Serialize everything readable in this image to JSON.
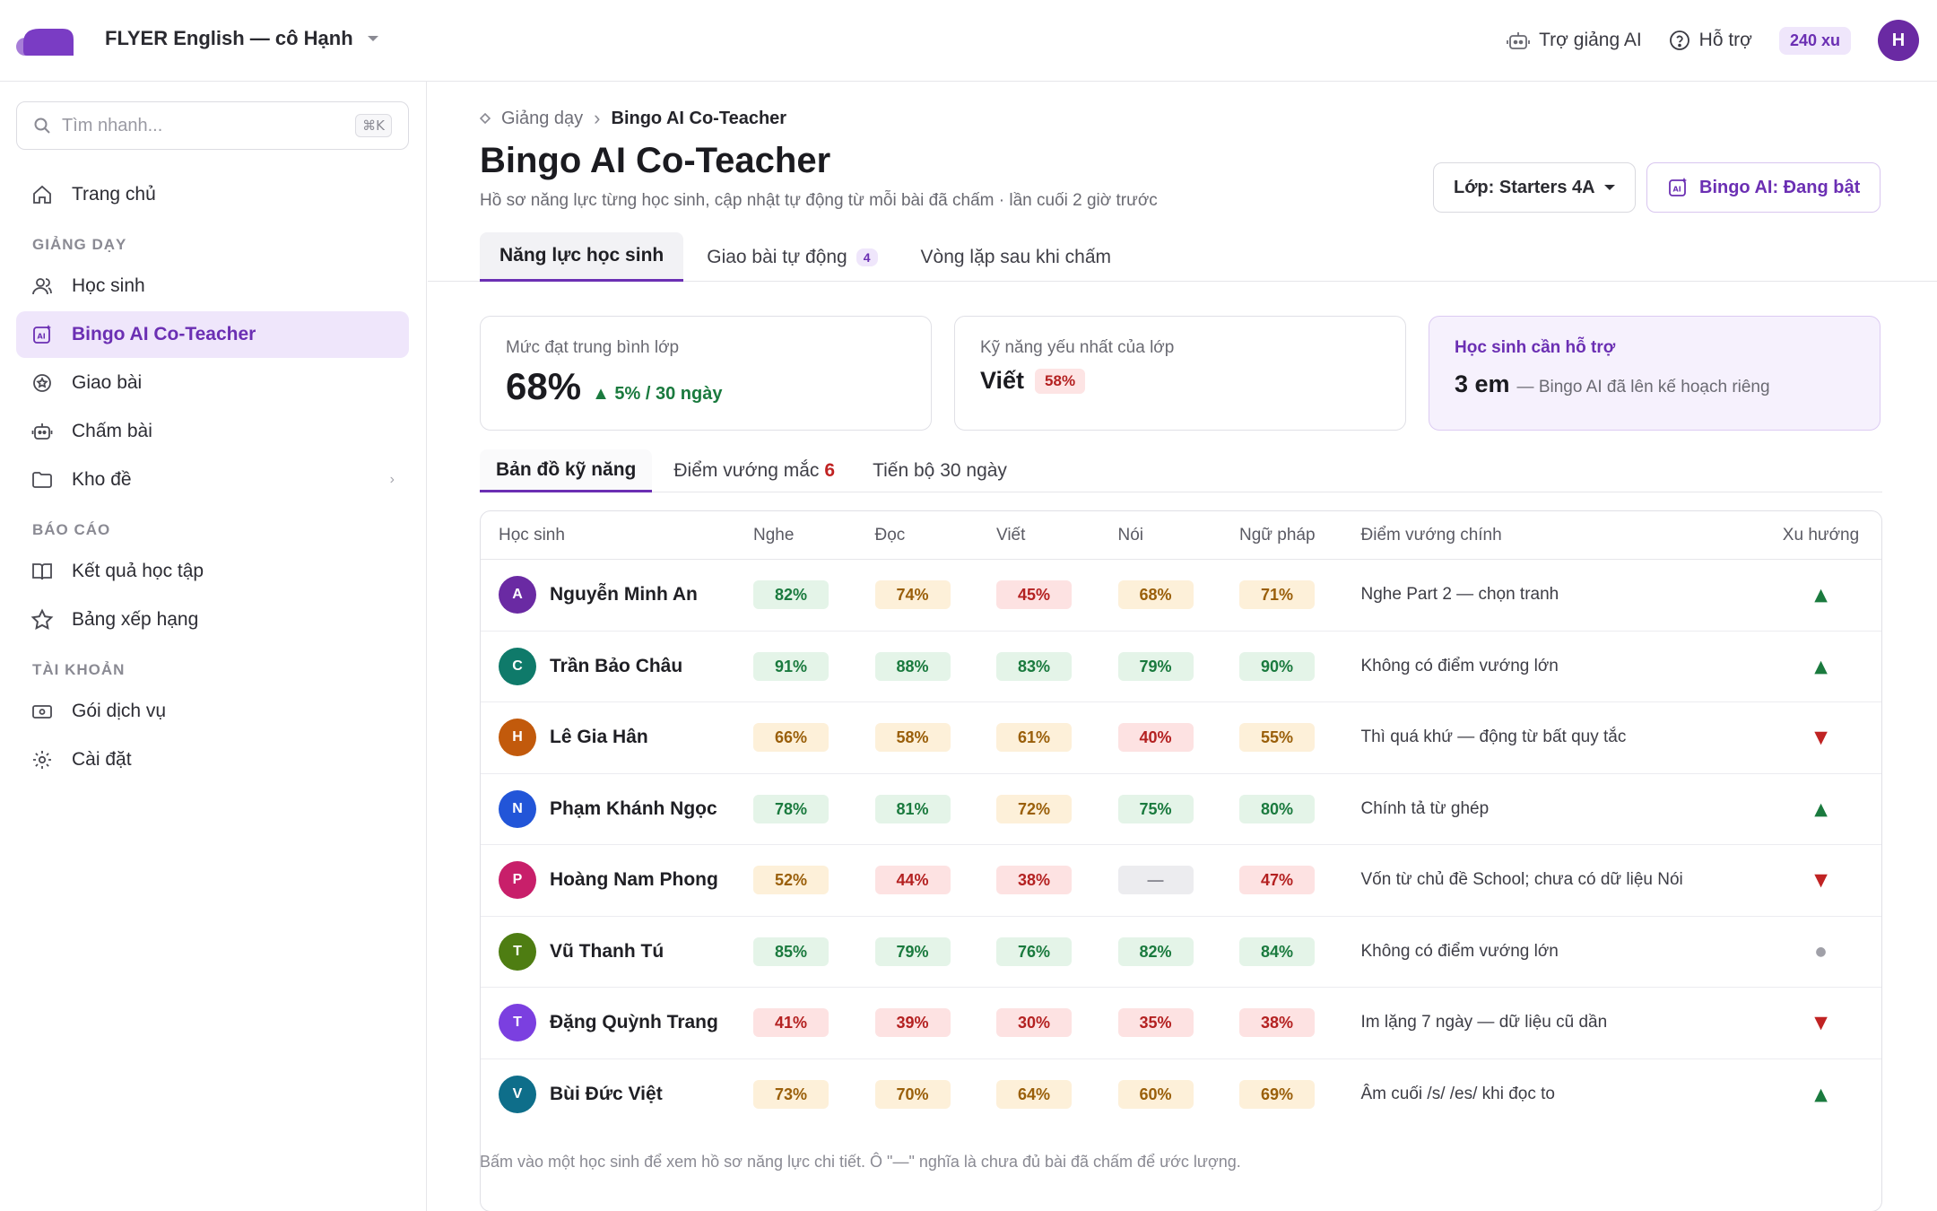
{
  "header": {
    "workspace": "FLYER English — cô Hạnh",
    "ai_assistant": "Trợ giảng AI",
    "support": "Hỗ trợ",
    "coins": "240 xu",
    "avatar_initial": "H"
  },
  "sidebar": {
    "search_placeholder": "Tìm nhanh...",
    "search_shortcut": "⌘K",
    "home": "Trang chủ",
    "sections": {
      "teaching": "GIẢNG DẠY",
      "reports": "BÁO CÁO",
      "account": "TÀI KHOẢN"
    },
    "items": {
      "students": "Học sinh",
      "bingo": "Bingo AI Co-Teacher",
      "assign": "Giao bài",
      "grade": "Chấm bài",
      "bank": "Kho đề",
      "results": "Kết quả học tập",
      "ranking": "Bảng xếp hạng",
      "plans": "Gói dịch vụ",
      "settings": "Cài đặt"
    }
  },
  "main": {
    "breadcrumb": {
      "parent": "Giảng dạy",
      "current": "Bingo AI Co-Teacher"
    },
    "title": "Bingo AI Co-Teacher",
    "subtitle": "Hồ sơ năng lực từng học sinh, cập nhật tự động từ mỗi bài đã chấm · lần cuối 2 giờ trước",
    "class_select": "Lớp: Starters 4A",
    "ai_toggle": "Bingo AI: Đang bật",
    "tabs": [
      {
        "label": "Năng lực học sinh",
        "active": true
      },
      {
        "label": "Giao bài tự động",
        "count": "4"
      },
      {
        "label": "Vòng lặp sau khi chấm"
      }
    ],
    "stats": {
      "avg": {
        "label": "Mức đạt trung bình lớp",
        "value": "68%",
        "trend": "▲ 5% / 30 ngày"
      },
      "weakest": {
        "label": "Kỹ năng yếu nhất của lớp",
        "value": "Viết",
        "chip": "58%"
      },
      "support": {
        "label": "Học sinh cần hỗ trợ",
        "value": "3 em",
        "note": "— Bingo AI đã lên kế hoạch riêng"
      }
    },
    "subtabs": {
      "map": "Bản đồ kỹ năng",
      "issues": "Điểm vướng mắc",
      "issues_count": "6",
      "progress": "Tiến bộ 30 ngày"
    },
    "table": {
      "headers": [
        "Học sinh",
        "Nghe",
        "Đọc",
        "Viết",
        "Nói",
        "Ngữ pháp",
        "Điểm vướng chính",
        "Xu hướng"
      ],
      "rows": [
        {
          "initial": "A",
          "color": "#6a2aa3",
          "name": "Nguyễn Minh An",
          "scores": [
            [
              "82%",
              "g"
            ],
            [
              "74%",
              "y"
            ],
            [
              "45%",
              "r"
            ],
            [
              "68%",
              "y"
            ],
            [
              "71%",
              "y"
            ]
          ],
          "issue": "Nghe Part 2 — chọn tranh",
          "trend": "▲",
          "trend_type": "up"
        },
        {
          "initial": "C",
          "color": "#0f7a6a",
          "name": "Trần Bảo Châu",
          "scores": [
            [
              "91%",
              "g"
            ],
            [
              "88%",
              "g"
            ],
            [
              "83%",
              "g"
            ],
            [
              "79%",
              "g"
            ],
            [
              "90%",
              "g"
            ]
          ],
          "issue": "Không có điểm vướng lớn",
          "trend": "▲",
          "trend_type": "up"
        },
        {
          "initial": "H",
          "color": "#c25a0c",
          "name": "Lê Gia Hân",
          "scores": [
            [
              "66%",
              "y"
            ],
            [
              "58%",
              "y"
            ],
            [
              "61%",
              "y"
            ],
            [
              "40%",
              "r"
            ],
            [
              "55%",
              "y"
            ]
          ],
          "issue": "Thì quá khứ — động từ bất quy tắc",
          "trend": "▼",
          "trend_type": "down"
        },
        {
          "initial": "N",
          "color": "#2255d8",
          "name": "Phạm Khánh Ngọc",
          "scores": [
            [
              "78%",
              "g"
            ],
            [
              "81%",
              "g"
            ],
            [
              "72%",
              "y"
            ],
            [
              "75%",
              "g"
            ],
            [
              "80%",
              "g"
            ]
          ],
          "issue": "Chính tả từ ghép",
          "trend": "▲",
          "trend_type": "up"
        },
        {
          "initial": "P",
          "color": "#c81f6a",
          "name": "Hoàng Nam Phong",
          "scores": [
            [
              "52%",
              "y"
            ],
            [
              "44%",
              "r"
            ],
            [
              "38%",
              "r"
            ],
            [
              "—",
              "n"
            ],
            [
              "47%",
              "r"
            ]
          ],
          "issue": "Vốn từ chủ đề School; chưa có dữ liệu Nói",
          "trend": "▼",
          "trend_type": "down"
        },
        {
          "initial": "T",
          "color": "#4e7d12",
          "name": "Vũ Thanh Tú",
          "scores": [
            [
              "85%",
              "g"
            ],
            [
              "79%",
              "g"
            ],
            [
              "76%",
              "g"
            ],
            [
              "82%",
              "g"
            ],
            [
              "84%",
              "g"
            ]
          ],
          "issue": "Không có điểm vướng lớn",
          "trend": "●",
          "trend_type": "flat"
        },
        {
          "initial": "T",
          "color": "#7b3fe0",
          "name": "Đặng Quỳnh Trang",
          "scores": [
            [
              "41%",
              "r"
            ],
            [
              "39%",
              "r"
            ],
            [
              "30%",
              "r"
            ],
            [
              "35%",
              "r"
            ],
            [
              "38%",
              "r"
            ]
          ],
          "issue": "Im lặng 7 ngày — dữ liệu cũ dần",
          "trend": "▼",
          "trend_type": "down"
        },
        {
          "initial": "V",
          "color": "#0e6e8a",
          "name": "Bùi Đức Việt",
          "scores": [
            [
              "73%",
              "y"
            ],
            [
              "70%",
              "y"
            ],
            [
              "64%",
              "y"
            ],
            [
              "60%",
              "y"
            ],
            [
              "69%",
              "y"
            ]
          ],
          "issue": "Âm cuối /s/ /es/ khi đọc to",
          "trend": "▲",
          "trend_type": "up"
        }
      ]
    },
    "footnote": "Bấm vào một học sinh để xem hồ sơ năng lực chi tiết. Ô \"—\" nghĩa là chưa đủ bài đã chấm để ước lượng."
  }
}
